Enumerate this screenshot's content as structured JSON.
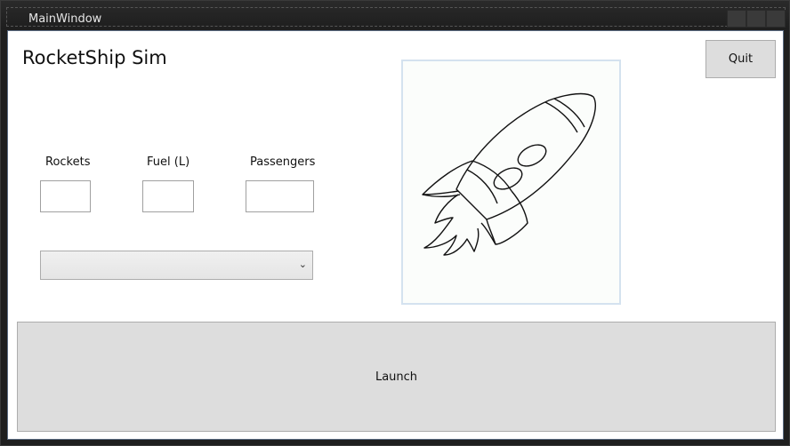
{
  "window": {
    "title": "MainWindow"
  },
  "app": {
    "title": "RocketShip Sim"
  },
  "fields": {
    "rockets": {
      "label": "Rockets",
      "value": ""
    },
    "fuel": {
      "label": "Fuel (L)",
      "value": ""
    },
    "passengers": {
      "label": "Passengers",
      "value": ""
    }
  },
  "dropdown": {
    "selected": ""
  },
  "image": {
    "icon": "rocket-icon"
  },
  "buttons": {
    "quit": "Quit",
    "launch": "Launch"
  }
}
